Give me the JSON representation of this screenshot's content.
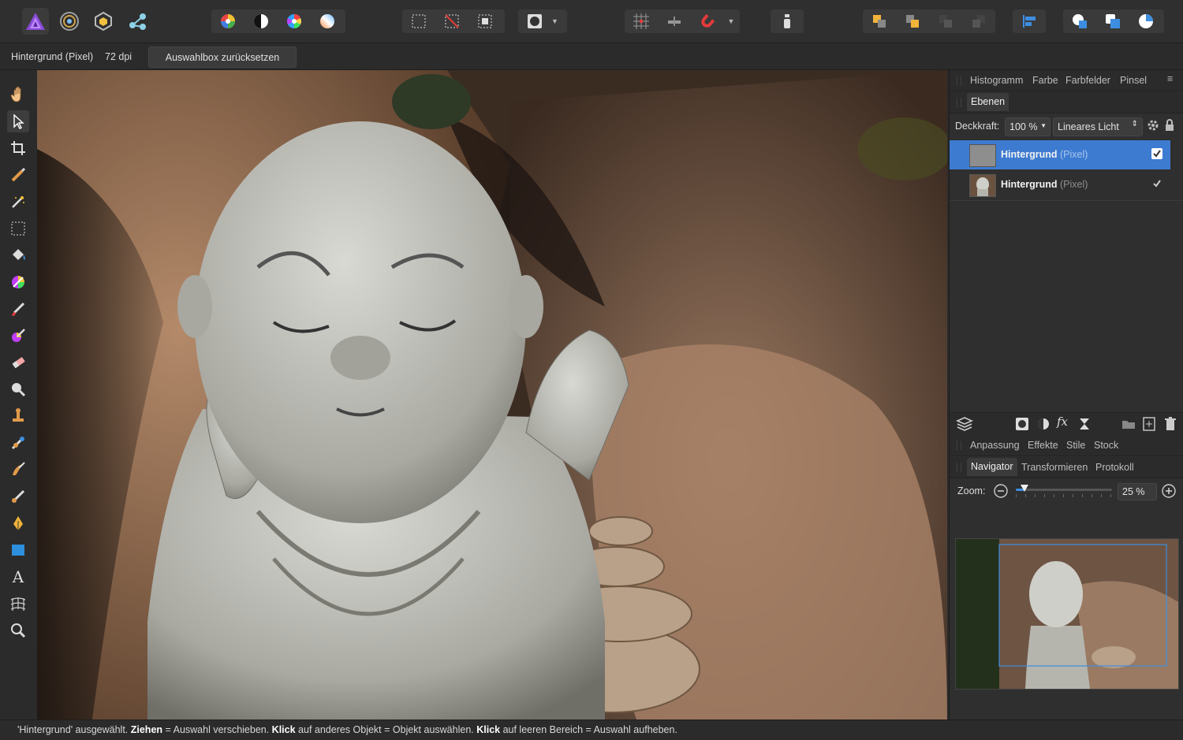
{
  "context_bar": {
    "layer_label": "Hintergrund (Pixel)",
    "dpi": "72 dpi",
    "reset_button": "Auswahlbox zurücksetzen"
  },
  "panels": {
    "top_tabs": [
      "Histogramm",
      "Farbe",
      "Farbfelder",
      "Pinsel"
    ],
    "layers": {
      "tab": "Ebenen",
      "opacity_label": "Deckkraft:",
      "opacity_value": "100 %",
      "blend_mode": "Lineares Licht",
      "items": [
        {
          "name": "Hintergrund",
          "type": "(Pixel)",
          "selected": true
        },
        {
          "name": "Hintergrund",
          "type": "(Pixel)",
          "selected": false
        }
      ]
    },
    "mid_tabs": [
      "Anpassung",
      "Effekte",
      "Stile",
      "Stock"
    ],
    "navigator": {
      "tabs": [
        "Navigator",
        "Transformieren",
        "Protokoll"
      ],
      "zoom_label": "Zoom:",
      "zoom_value": "25 %",
      "zoom_level": 0.05
    }
  },
  "status": {
    "parts": [
      {
        "text": "'Hintergrund' ausgewählt. ",
        "bold": false
      },
      {
        "text": "Ziehen",
        "bold": true
      },
      {
        "text": " = Auswahl verschieben. ",
        "bold": false
      },
      {
        "text": "Klick",
        "bold": true
      },
      {
        "text": " auf anderes Objekt = Objekt auswählen. ",
        "bold": false
      },
      {
        "text": "Klick",
        "bold": true
      },
      {
        "text": " auf leeren Bereich = Auswahl aufheben.",
        "bold": false
      }
    ]
  },
  "colors": {
    "selection_blue": "#3d7bd1",
    "affinity_purple": "#8a4bd6"
  },
  "toolbar_icons": [
    "affinity-photo-icon",
    "develop-persona-icon",
    "liquify-persona-icon",
    "export-persona-icon",
    "color-wheel-icon",
    "contrast-icon",
    "saturation-icon",
    "white-balance-icon",
    "marquee-icon",
    "deselect-icon",
    "invert-selection-icon",
    "quick-mask-icon",
    "grid-icon",
    "snap-icon",
    "magnet-icon",
    "info-icon",
    "arrange-icons",
    "align-icon",
    "boolean-icons"
  ],
  "left_tools": [
    "hand-icon",
    "move-icon",
    "crop-icon",
    "selection-brush-icon",
    "magic-wand-icon",
    "marquee-select-icon",
    "flood-fill-icon",
    "color-picker-icon",
    "paint-brush-icon",
    "color-replace-icon",
    "erase-icon",
    "dodge-icon",
    "clone-icon",
    "healing-icon",
    "smudge-icon",
    "mixer-brush-icon",
    "pen-icon",
    "rectangle-icon",
    "text-icon",
    "mesh-warp-icon",
    "zoom-icon"
  ]
}
